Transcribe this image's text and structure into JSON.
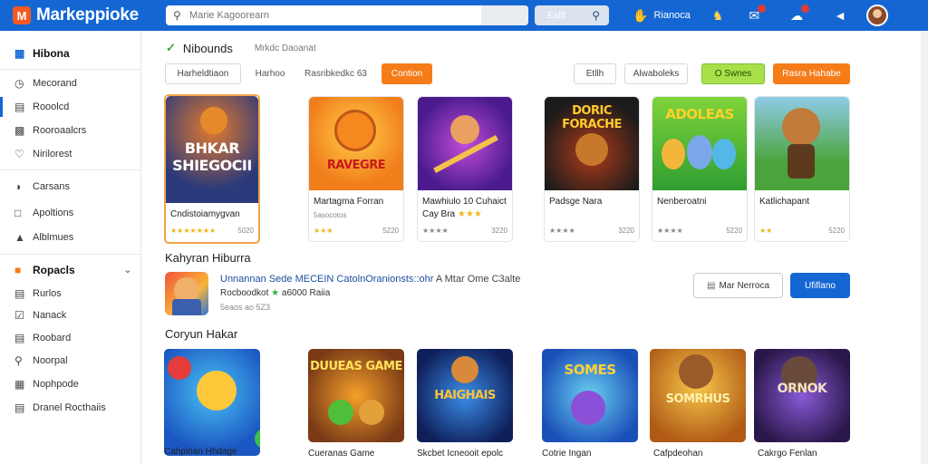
{
  "app": {
    "logo_glyph": "M",
    "logo_text": "Markeppioke",
    "accent": "#1467d3",
    "search_placeholder": "Marie Kagoorearn",
    "search_button": "Ealft",
    "nav_label": "Rianoca",
    "brand_orange": "#f25a22"
  },
  "sidebar": {
    "items": [
      {
        "label": "Hibona",
        "icon": "grid-icon"
      },
      {
        "label": "Mecorand",
        "icon": "clock-icon"
      },
      {
        "label": "Rooolcd",
        "icon": "doc-icon"
      },
      {
        "label": "Rooroaalcrs",
        "icon": "list-icon"
      },
      {
        "label": "Nirilorest",
        "icon": "heart-icon"
      },
      {
        "label": "Carsans",
        "icon": "tag-icon"
      },
      {
        "label": "Apoltions",
        "icon": "box-icon"
      },
      {
        "label": "Alblmues",
        "icon": "chart-icon"
      },
      {
        "label": "Ropacls",
        "icon": "folder-icon"
      },
      {
        "label": "Rurlos",
        "icon": "folder-icon"
      },
      {
        "label": "Nanack",
        "icon": "check-icon"
      },
      {
        "label": "Roobard",
        "icon": "doc-icon"
      },
      {
        "label": "Noorpal",
        "icon": "pin-icon"
      },
      {
        "label": "Nophpode",
        "icon": "grid-icon"
      },
      {
        "label": "Dranel Rocthaiis",
        "icon": "doc-icon"
      }
    ]
  },
  "header": {
    "title": "Nibounds",
    "subtitle": "Mrkdc Daoanat"
  },
  "filters": {
    "left": [
      "Harheldtiaon",
      "Harhoo",
      "Rasribkedkc 63",
      "Contion"
    ],
    "right": [
      "Etllh",
      "Alwaboleks",
      "O Swnes",
      "Rasra Hahabe"
    ]
  },
  "row1": [
    {
      "title": "Cndistoiamygvan",
      "art": "BHKAR SHIEGOCII",
      "rating": "★★★★★★★",
      "price": "5020"
    },
    {
      "title": "Martagma Forran",
      "art": "RAVEGRE",
      "rating": "5asocotos",
      "price": "5220"
    },
    {
      "title": "Mawhiulo 10 Cuhaict",
      "art": "",
      "subtitle": "Cay Bra",
      "stars": "★★★",
      "rating": "★★★★",
      "price": "3220"
    },
    {
      "title": "Padsge Nara",
      "art": "DORIC FORACHE",
      "rating": "★★★★",
      "price": "3220"
    },
    {
      "title": "Nenberoatni",
      "art": "ADOLEAS",
      "rating": "★★★★",
      "price": "5220"
    },
    {
      "title": "Katlichapant",
      "art": "",
      "rating": "★★",
      "price": "5220"
    }
  ],
  "featured": {
    "section": "Kahyran Hiburra",
    "title_blue": "Unnannan Sede MECEIN CatolnOranionsts::ohr",
    "title_rest": "A Mtar Ome C3alte",
    "sub": "Rocboodkot",
    "sub_star": "★",
    "sub_rest": "a6000 Raiia",
    "meta": "5eaos ao 5Z3",
    "btn_outline": "Mar Nerroca",
    "btn_blue": "Ufiflano"
  },
  "section2": {
    "title": "Coryun Hakar"
  },
  "row2": [
    {
      "title": "Cahpinan Hhdage",
      "art": ""
    },
    {
      "title": "Cueranas Game",
      "art": "DUUEAS GAME"
    },
    {
      "title": "Skcbet Icneooit epolc",
      "art": "HAIGHAIS"
    },
    {
      "title": "Cotrie Ingan",
      "art": "SOMES"
    },
    {
      "title": "Cafpdeohan",
      "art": "SOMRHUS"
    },
    {
      "title": "Cakrgo Fenlan",
      "art": "ORNOK"
    }
  ],
  "icons": [
    "search-icon",
    "bell-icon",
    "hand-icon",
    "chat-icon",
    "cloud-icon",
    "gift-icon"
  ]
}
